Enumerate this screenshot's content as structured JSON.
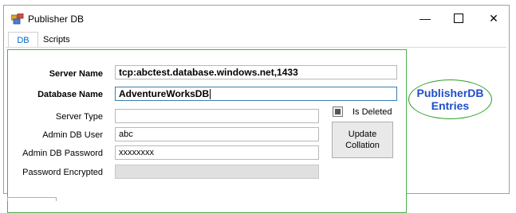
{
  "window": {
    "title": "Publisher DB",
    "controls": {
      "minimize": "—",
      "maximize": "",
      "close": "✕"
    }
  },
  "tabs": [
    {
      "label": "DB",
      "selected": true
    },
    {
      "label": "Scripts",
      "selected": false
    }
  ],
  "form": {
    "server_name": {
      "label": "Server Name",
      "value": "tcp:abctest.database.windows.net,1433"
    },
    "database_name": {
      "label": "Database Name",
      "value": "AdventureWorksDB"
    },
    "server_type": {
      "label": "Server Type",
      "value": ""
    },
    "admin_user": {
      "label": "Admin DB User",
      "value": "abc"
    },
    "admin_password": {
      "label": "Admin DB Password",
      "value": "xxxxxxxx"
    },
    "password_encrypted": {
      "label": "Password Encrypted",
      "value": ""
    },
    "is_deleted": {
      "label": "Is Deleted",
      "checked": "indeterminate"
    },
    "update_button": {
      "line1": "Update",
      "line2": "Collation"
    }
  },
  "annotation": {
    "line1": "PublisherDB",
    "line2": "Entries"
  },
  "colors": {
    "panel_border": "#4caf50",
    "annotation_text": "#1f4ec9",
    "annotation_border": "#2e9e2e",
    "tab_selected": "#0066cc"
  }
}
